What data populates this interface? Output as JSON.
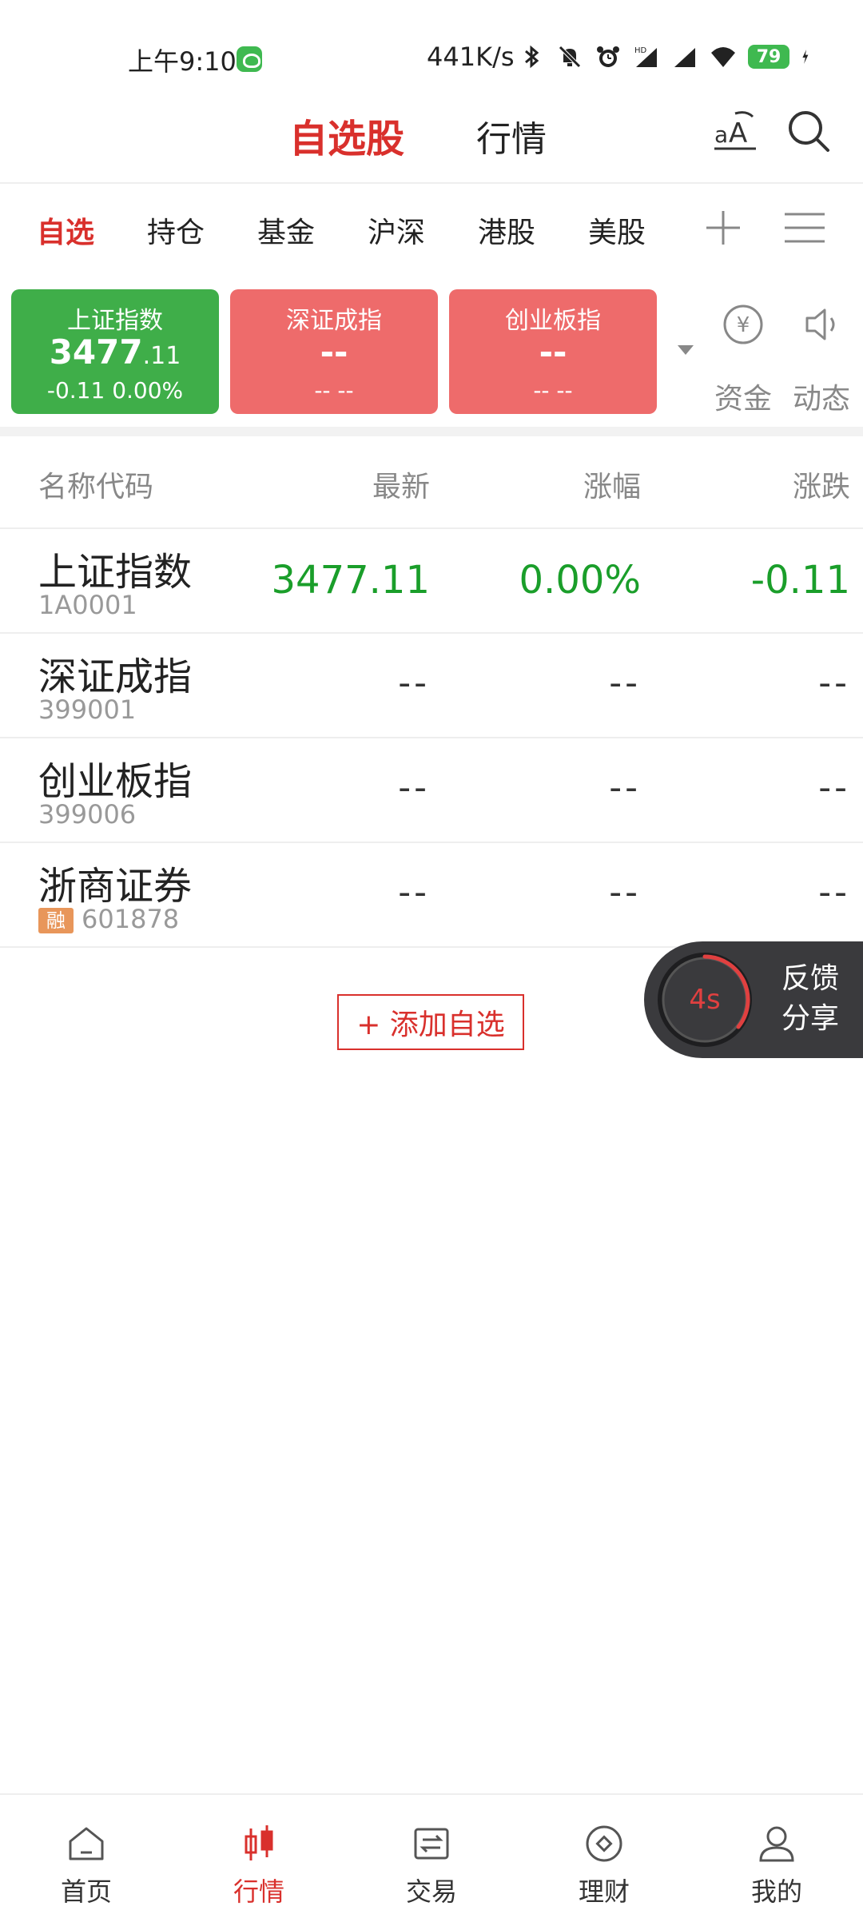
{
  "status_bar": {
    "time": "上午9:10",
    "net_speed": "441K/s",
    "battery": "79",
    "icons": [
      "bluetooth-icon",
      "mute-bell-icon",
      "alarm-icon",
      "hd-signal-icon",
      "signal-icon",
      "wifi-icon",
      "battery-icon",
      "charging-icon"
    ]
  },
  "header": {
    "tab_watchlist": "自选股",
    "tab_market": "行情"
  },
  "category_tabs": [
    {
      "label": "自选",
      "active": true
    },
    {
      "label": "持仓",
      "active": false
    },
    {
      "label": "基金",
      "active": false
    },
    {
      "label": "沪深",
      "active": false
    },
    {
      "label": "港股",
      "active": false
    },
    {
      "label": "美股",
      "active": false
    }
  ],
  "index_cards": [
    {
      "name": "上证指数",
      "value_int": "3477",
      "value_dec": ".11",
      "change": "-0.11  0.00%",
      "color": "#3fae49"
    },
    {
      "name": "深证成指",
      "value_int": "--",
      "value_dec": "",
      "change": "-- --",
      "color": "#ee6b6b"
    },
    {
      "name": "创业板指",
      "value_int": "--",
      "value_dec": "",
      "change": "-- --",
      "color": "#ee6b6b"
    }
  ],
  "side_actions": {
    "funds_label": "资金",
    "news_label": "动态"
  },
  "table": {
    "headers": [
      "名称代码",
      "最新",
      "涨幅",
      "涨跌"
    ],
    "rows": [
      {
        "name": "上证指数",
        "code": "1A0001",
        "badge": "",
        "latest": "3477.11",
        "pct": "0.00%",
        "change": "-0.11"
      },
      {
        "name": "深证成指",
        "code": "399001",
        "badge": "",
        "latest": "--",
        "pct": "--",
        "change": "--"
      },
      {
        "name": "创业板指",
        "code": "399006",
        "badge": "",
        "latest": "--",
        "pct": "--",
        "change": "--"
      },
      {
        "name": "浙商证券",
        "code": "601878",
        "badge": "融",
        "latest": "--",
        "pct": "--",
        "change": "--"
      }
    ]
  },
  "add_watch_label": "+ 添加自选",
  "feedback": {
    "timer": "4s",
    "line1": "反馈",
    "line2": "分享"
  },
  "bottom_nav": [
    {
      "label": "首页",
      "icon": "home-icon",
      "active": false
    },
    {
      "label": "行情",
      "icon": "candlestick-icon",
      "active": true
    },
    {
      "label": "交易",
      "icon": "exchange-icon",
      "active": false
    },
    {
      "label": "理财",
      "icon": "wealth-icon",
      "active": false
    },
    {
      "label": "我的",
      "icon": "user-icon",
      "active": false
    }
  ],
  "colors": {
    "accent": "#d9302c",
    "up_green": "#1a9e2a",
    "card_green": "#3fae49",
    "card_red": "#ee6b6b"
  }
}
